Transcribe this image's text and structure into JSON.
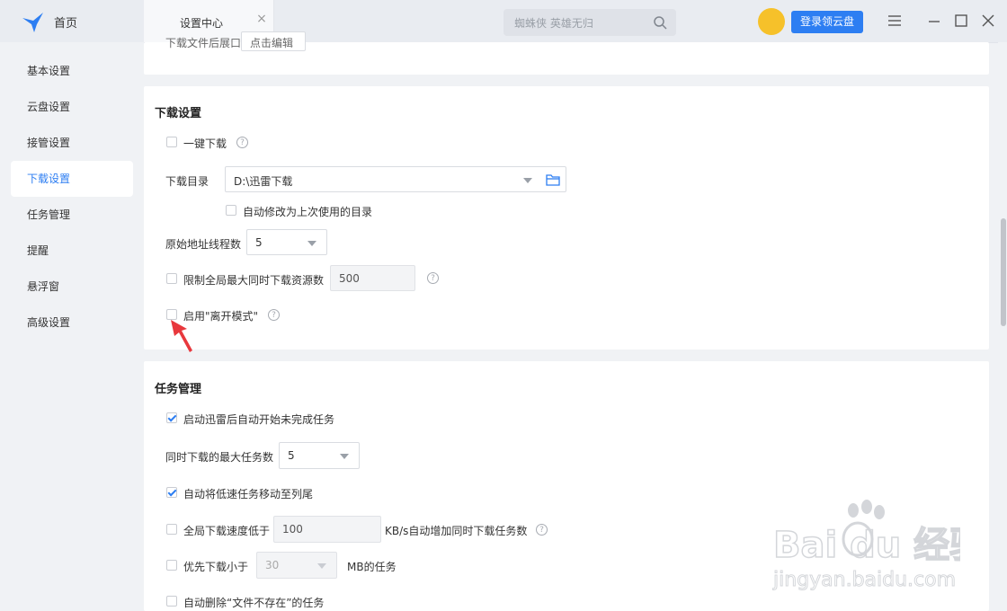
{
  "topbar": {
    "home_label": "首页",
    "tab_title": "设置中心",
    "tab_close": "×",
    "search_placeholder": "蜘蛛侠 英雄无归",
    "login_label": "登录领云盘"
  },
  "sidebar": {
    "items": [
      {
        "label": "基本设置"
      },
      {
        "label": "云盘设置"
      },
      {
        "label": "接管设置"
      },
      {
        "label": "下载设置",
        "active": true
      },
      {
        "label": "任务管理"
      },
      {
        "label": "提醒"
      },
      {
        "label": "悬浮窗"
      },
      {
        "label": "高级设置"
      }
    ]
  },
  "top_card": {
    "partial_label": "下载文件后展口",
    "partial_button": "点击编辑"
  },
  "download_settings": {
    "title": "下载设置",
    "one_click_label": "一键下载",
    "one_click_checked": false,
    "dir_label": "下载目录",
    "dir_value": "D:\\迅雷下载",
    "auto_modify_label": "自动修改为上次使用的目录",
    "auto_modify_checked": false,
    "threads_label": "原始地址线程数",
    "threads_value": "5",
    "limit_label": "限制全局最大同时下载资源数",
    "limit_value": "500",
    "limit_checked": false,
    "away_mode_label": "启用\"离开模式\"",
    "away_mode_checked": false
  },
  "task_management": {
    "title": "任务管理",
    "auto_start_label": "启动迅雷后自动开始未完成任务",
    "auto_start_checked": true,
    "max_tasks_label": "同时下载的最大任务数",
    "max_tasks_value": "5",
    "move_slow_label": "自动将低速任务移动至列尾",
    "move_slow_checked": true,
    "speed_below_label": "全局下载速度低于",
    "speed_below_value": "100",
    "speed_below_suffix": "KB/s自动增加同时下载任务数",
    "speed_below_checked": false,
    "priority_small_label": "优先下载小于",
    "priority_small_value": "30",
    "priority_small_suffix": "MB的任务",
    "priority_small_checked": false,
    "delete_missing_label": "自动删除“文件不存在”的任务",
    "delete_missing_checked": false
  },
  "help_glyph": "?",
  "watermark": {
    "brand_text": "Bai du 经验",
    "url_text": "jingyan.baidu.com"
  },
  "colors": {
    "accent": "#2d7ef2",
    "avatar": "#f6c12a",
    "arrow": "#e8383d"
  }
}
